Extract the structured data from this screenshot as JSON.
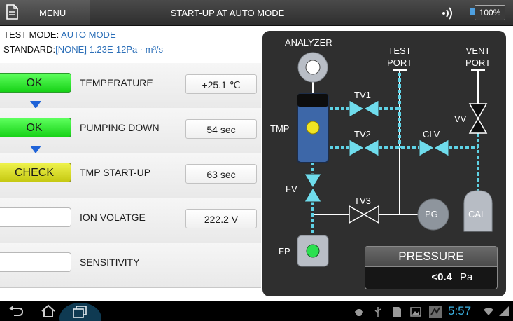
{
  "topbar": {
    "menu_label": "MENU",
    "title": "START-UP AT AUTO MODE",
    "battery": "100%"
  },
  "info": {
    "test_mode_label": "TEST MODE:",
    "test_mode_value": "AUTO MODE",
    "standard_label": "STANDARD:",
    "standard_value": "[NONE] 1.23E-12Pa · m³/s"
  },
  "rows": [
    {
      "status": "OK",
      "state": "ok",
      "label": "TEMPERATURE",
      "value": "+25.1 ℃"
    },
    {
      "status": "OK",
      "state": "ok",
      "label": "PUMPING DOWN",
      "value": "54 sec"
    },
    {
      "status": "CHECK",
      "state": "check",
      "label": "TMP START-UP",
      "value": "63 sec"
    },
    {
      "status": "",
      "state": "blank",
      "label": "ION VOLATGE",
      "value": "222.2 V"
    },
    {
      "status": "",
      "state": "blank",
      "label": "SENSITIVITY",
      "value": ""
    }
  ],
  "diagram": {
    "analyzer": "ANALYZER",
    "test_port_line1": "TEST",
    "test_port_line2": "PORT",
    "vent_port_line1": "VENT",
    "vent_port_line2": "PORT",
    "tv1": "TV1",
    "tv2": "TV2",
    "tv3": "TV3",
    "clv": "CLV",
    "vv": "VV",
    "tmp": "TMP",
    "fv": "FV",
    "fp": "FP",
    "pg": "PG",
    "cal": "CAL",
    "line_color": "#5fd3e6",
    "valve_color": "#6fdcec"
  },
  "pressure": {
    "title": "PRESSURE",
    "value": "<0.4",
    "unit": "Pa"
  },
  "navbar": {
    "clock": "5:57"
  }
}
